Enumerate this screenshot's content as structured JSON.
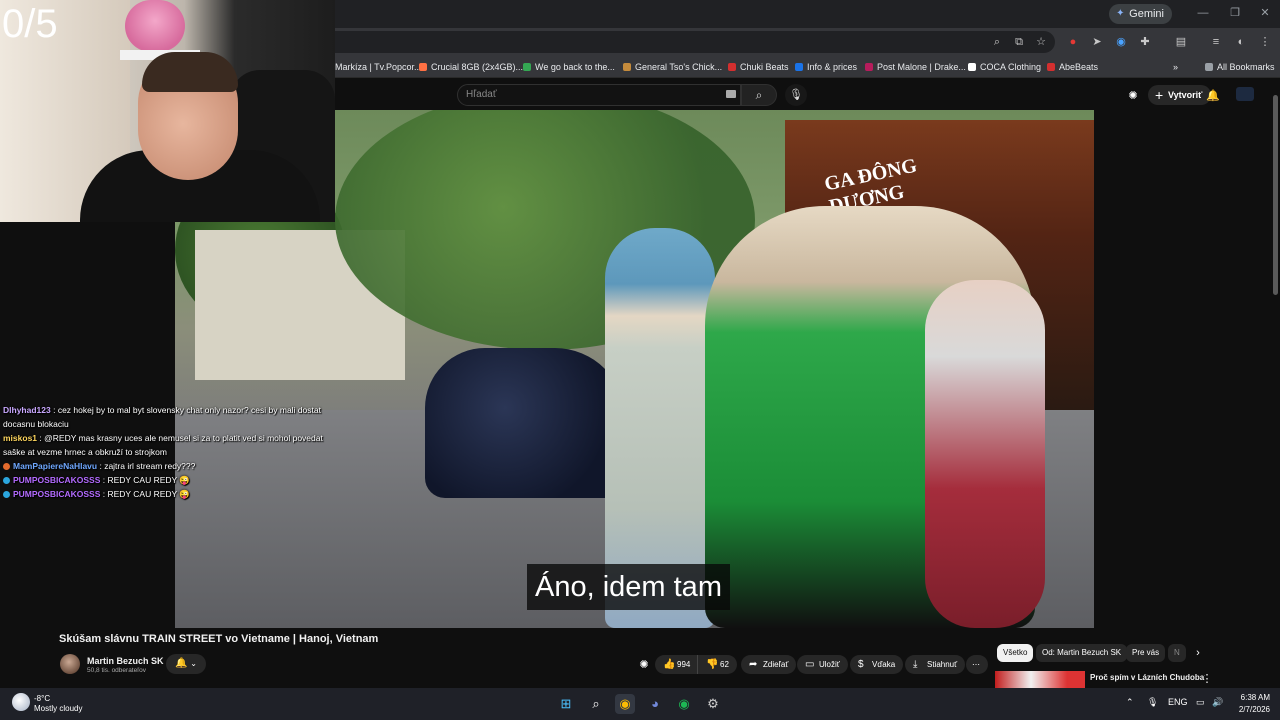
{
  "stream": {
    "counter": "0/5"
  },
  "browser": {
    "gemini_label": "Gemini",
    "bookmarks": [
      {
        "label": "Markíza | Tv.Popcor...",
        "color": "#e53935"
      },
      {
        "label": "Crucial 8GB (2x4GB)...",
        "color": "#ff7043"
      },
      {
        "label": "We go back to the...",
        "color": "#34a853"
      },
      {
        "label": "General Tso's Chick...",
        "color": "#c58b3c"
      },
      {
        "label": "Chuki Beats",
        "color": "#d32f2f"
      },
      {
        "label": "Info & prices",
        "color": "#1a73e8"
      },
      {
        "label": "Post Malone | Drake...",
        "color": "#b71c5c"
      },
      {
        "label": "COCA Clothing",
        "color": "#212121"
      },
      {
        "label": "AbeBeats",
        "color": "#d32f2f"
      }
    ],
    "all_bookmarks_label": "All Bookmarks"
  },
  "youtube": {
    "search_placeholder": "Hľadať",
    "create_label": "Vytvoriť",
    "subtitle": "Áno, idem tam",
    "video_title": "Skúšam slávnu TRAIN STREET vo Vietname | Hanoj, Vietnam",
    "channel_name": "Martin Bezuch SK",
    "channel_subs": "50,8 tis. odberateľov",
    "likes": "994",
    "dislikes": "62",
    "share_label": "Zdieľať",
    "save_label": "Uložiť",
    "thanks_label": "Vďaka",
    "download_label": "Stiahnuť",
    "chips": [
      "Všetko",
      "Od: Martin Bezuch SK",
      "Pre vás",
      "N"
    ],
    "related_title": "Proč spím v Lázních Chudoba? |",
    "shop_sign": "GA ĐÔNG DƯƠNG"
  },
  "chat": [
    {
      "user": "Dlhyhad123",
      "color": "#c9a8ff",
      "message": ": cez hokej by to mal byt slovensky chat only nazor? cesi by mali dostat docasnu blokaciu"
    },
    {
      "user": "miskos1",
      "color": "#ffd75e",
      "message": ": @REDY mas krasny uces ale nemusel si za to platit ved si mohol povedat saške at vezme hrnec a obkruží to strojkom"
    },
    {
      "user": "MamPapiereNaHlavu",
      "color": "#6fa8ff",
      "badge": "#e56b2d",
      "message": ": zajtra irl stream redy???"
    },
    {
      "user": "PUMPOSBICAKOSSS",
      "color": "#b36bff",
      "badge": "#2ba6de",
      "message": ": REDY CAU REDY 😜"
    },
    {
      "user": "PUMPOSBICAKOSSS",
      "color": "#b36bff",
      "badge": "#2ba6de",
      "message": ": REDY CAU REDY 😜"
    }
  ],
  "taskbar": {
    "temperature": "-8°C",
    "condition": "Mostly cloudy",
    "language": "ENG",
    "time": "6:38 AM",
    "date": "2/7/2026"
  }
}
